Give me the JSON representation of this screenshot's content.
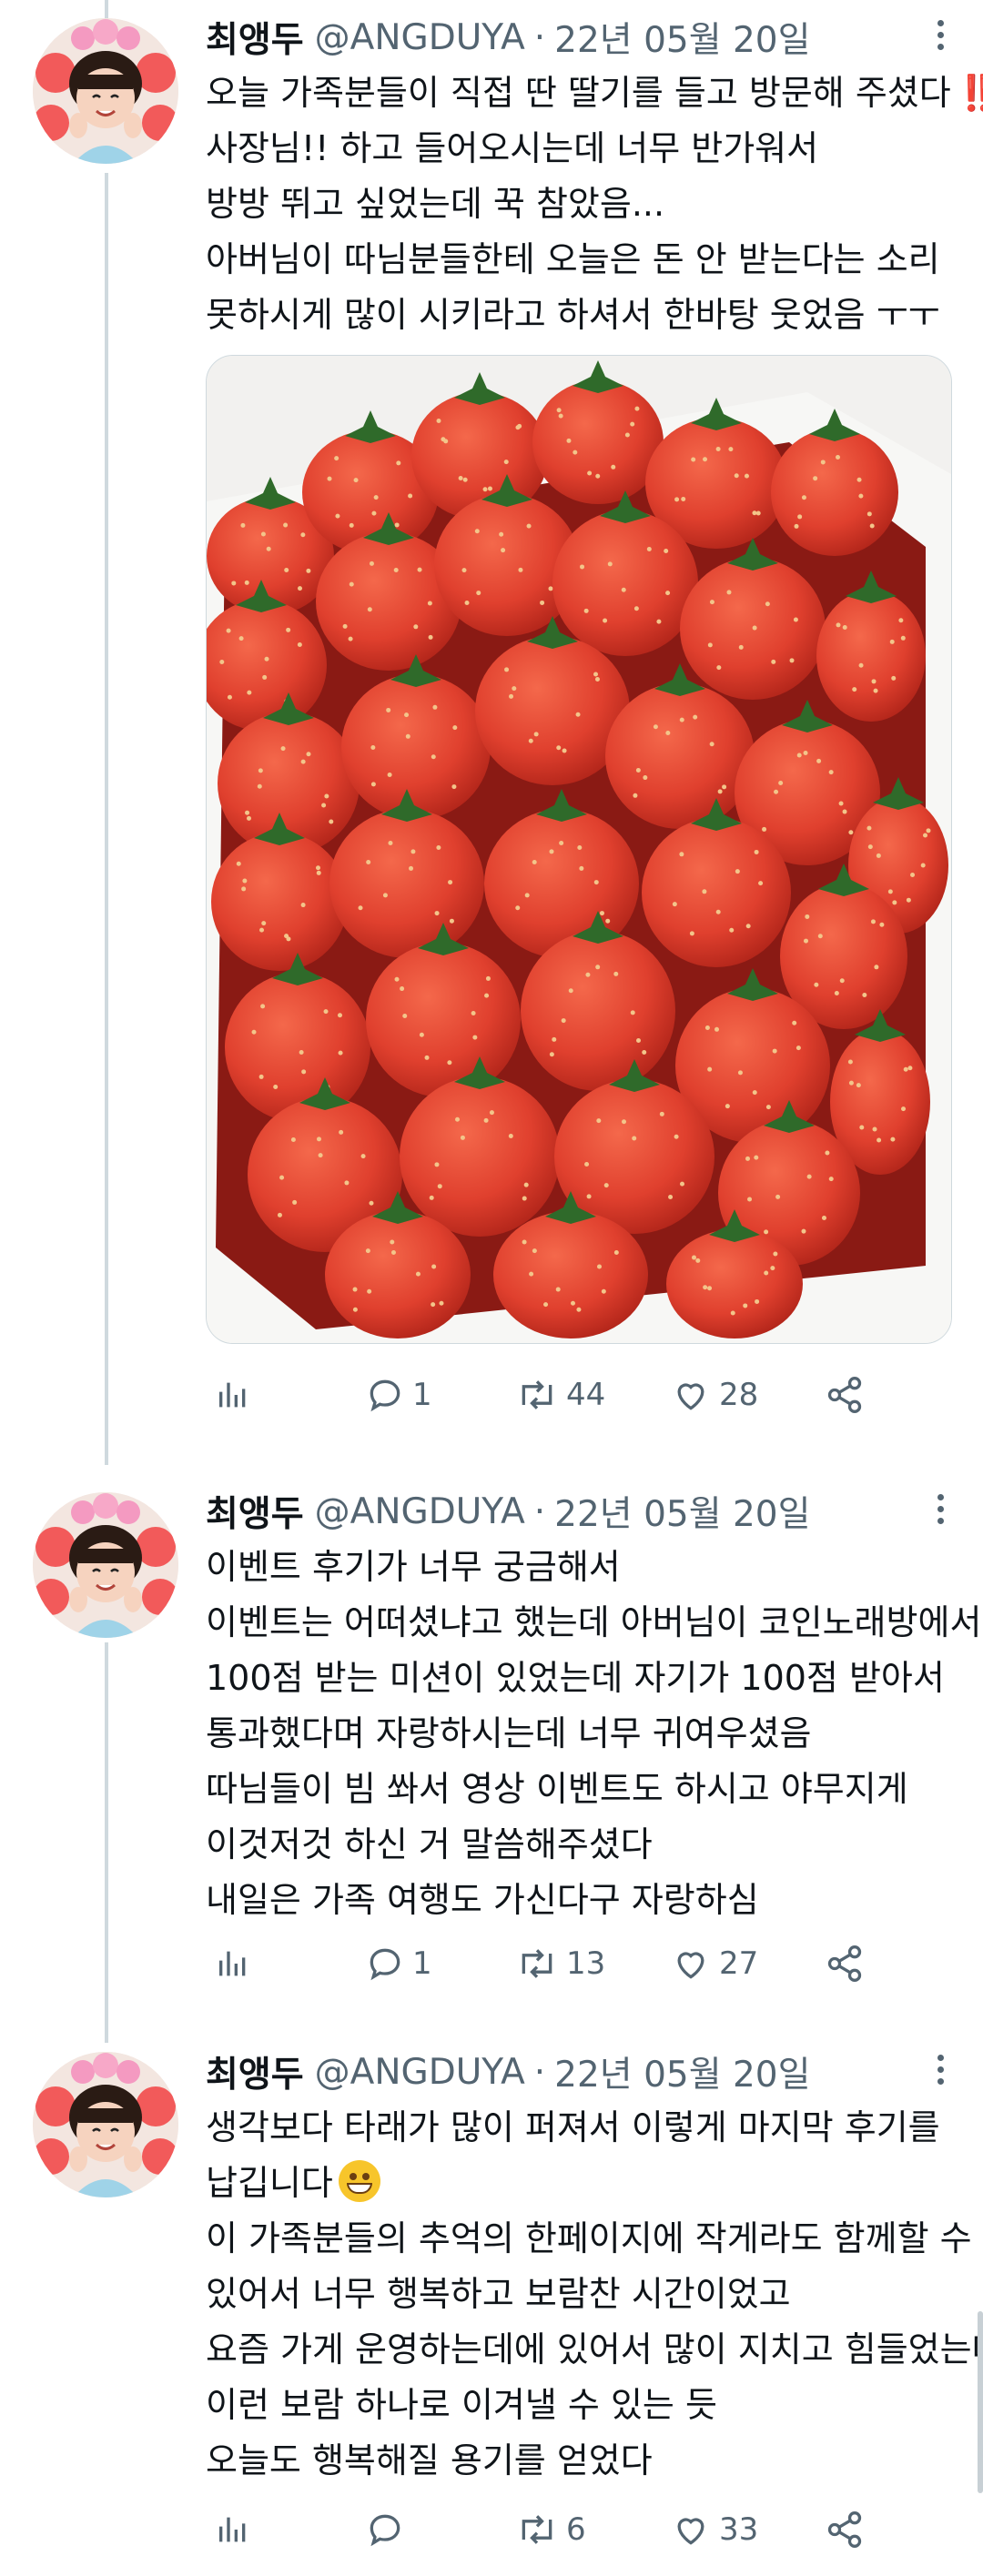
{
  "colors": {
    "secondary_text": "#536471",
    "thread_line": "#cfd9de",
    "accent_red": "#e0245e"
  },
  "tweets": [
    {
      "name": "최앵두",
      "handle": "@ANGDUYA",
      "separator": "·",
      "date": "22년 05월 20일",
      "lines": [
        "오늘 가족분들이 직접 딴 딸기를 들고 방문해 주셨다",
        "사장님!! 하고 들어오시는데 너무 반가워서",
        "방방 뛰고 싶었는데 꾹 참았음...",
        "아버님이 따님분들한테 오늘은 돈 안 받는다는 소리",
        "못하시게 많이 시키라고 하셔서 한바탕 웃었음 ㅜㅜ"
      ],
      "line1_emoji": "‼️",
      "replies": "1",
      "retweets": "44",
      "likes": "28"
    },
    {
      "name": "최앵두",
      "handle": "@ANGDUYA",
      "separator": "·",
      "date": "22년 05월 20일",
      "lines": [
        "이벤트 후기가 너무 궁금해서",
        "이벤트는 어떠셨냐고 했는데 아버님이 코인노래방에서",
        "100점 받는 미션이 있었는데 자기가 100점 받아서",
        "통과했다며 자랑하시는데 너무 귀여우셨음",
        "따님들이 빔 쏴서 영상 이벤트도 하시고 야무지게",
        "이것저것 하신 거 말씀해주셨다",
        "내일은 가족 여행도 가신다구 자랑하심"
      ],
      "replies": "1",
      "retweets": "13",
      "likes": "27"
    },
    {
      "name": "최앵두",
      "handle": "@ANGDUYA",
      "separator": "·",
      "date": "22년 05월 20일",
      "lines": [
        "생각보다 타래가 많이 퍼져서 이렇게 마지막 후기를",
        "납깁니다",
        "이 가족분들의 추억의 한페이지에 작게라도 함께할 수",
        "있어서 너무 행복하고 보람찬 시간이었고",
        "요즘 가게 운영하는데에 있어서 많이 지치고 힘들었는데",
        "이런 보람 하나로 이겨낼 수 있는 듯",
        "오늘도 행복해질 용기를 얻었다"
      ],
      "line2_emoji": "grinning-face-emoji",
      "replies": "",
      "retweets": "6",
      "likes": "33"
    }
  ]
}
